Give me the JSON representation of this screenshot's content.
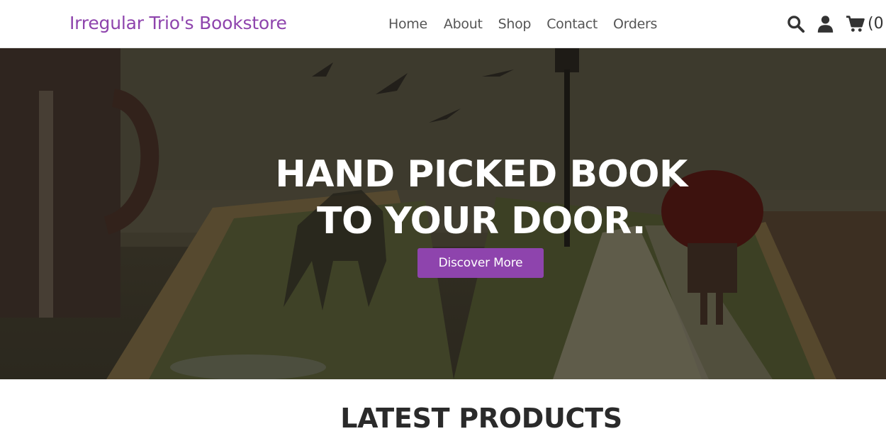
{
  "header": {
    "brand": "Irregular Trio's Bookstore",
    "nav": [
      "Home",
      "About",
      "Shop",
      "Contact",
      "Orders"
    ],
    "icons": [
      "search-icon",
      "user-icon",
      "cart-icon"
    ],
    "cart_count": "(0"
  },
  "hero": {
    "title_line1": "HAND PICKED BOOK",
    "title_line2": "TO YOUR DOOR.",
    "button_label": "Discover More"
  },
  "latest": {
    "title": "LATEST PRODUCTS"
  },
  "colors": {
    "accent": "#8e44ad",
    "nav_text": "#555555",
    "hero_text": "#ffffff"
  }
}
